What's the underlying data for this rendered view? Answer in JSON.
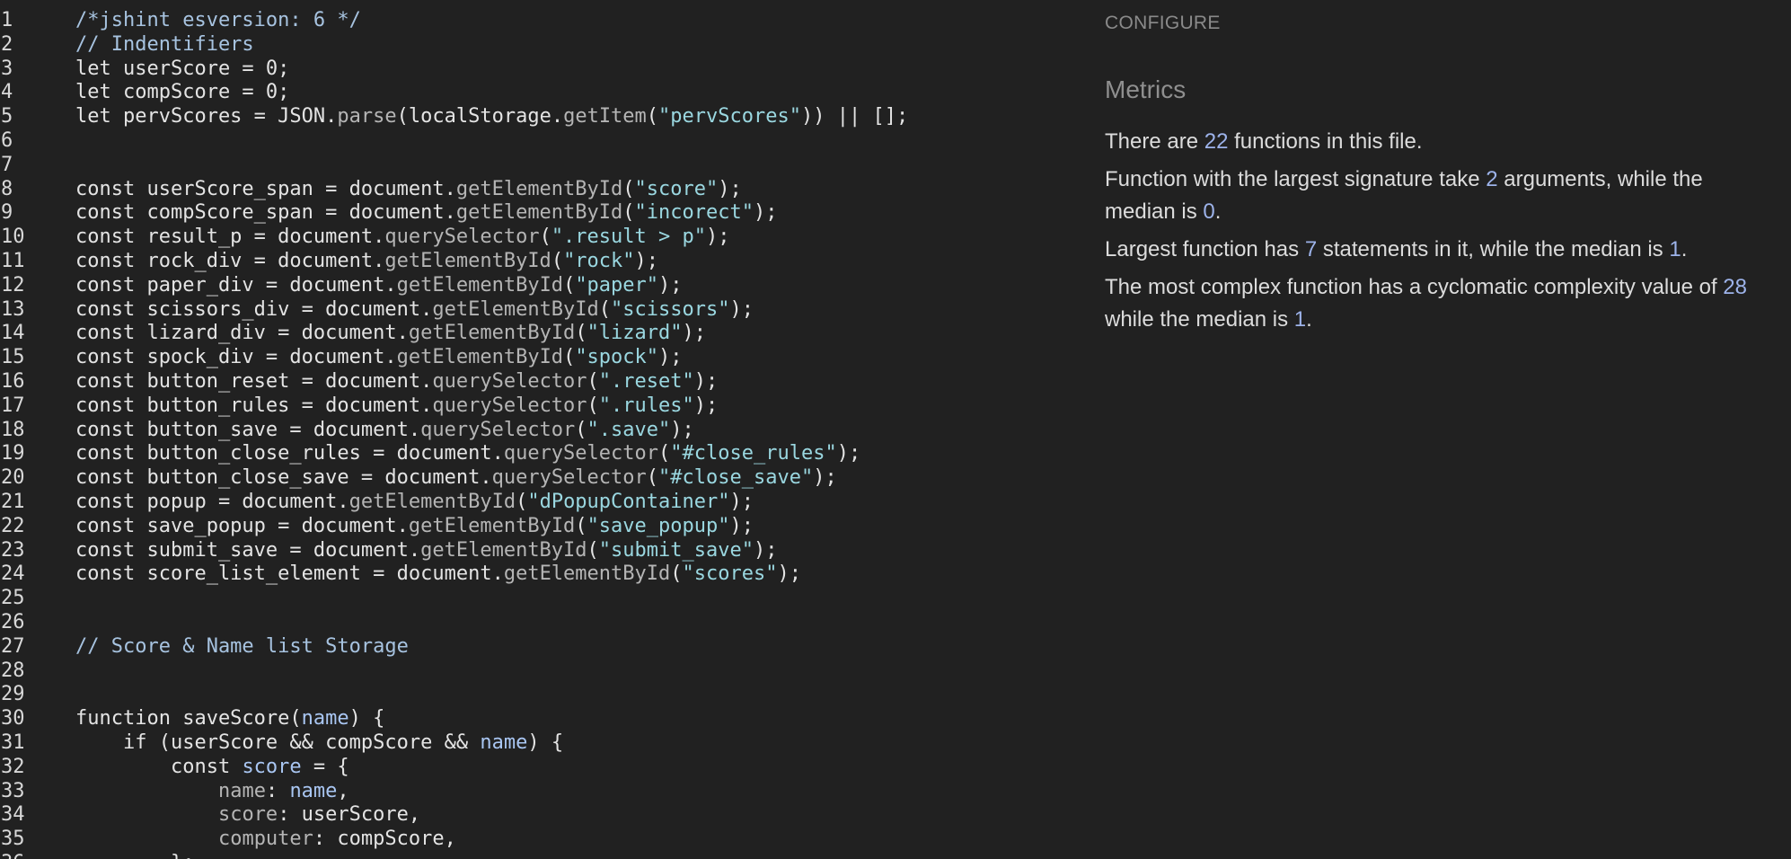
{
  "editor": {
    "lines": [
      [
        {
          "t": "/*jshint esversion: 6 */",
          "c": "comment"
        }
      ],
      [
        {
          "t": "// Indentifiers",
          "c": "comment"
        }
      ],
      [
        {
          "t": "let userScore = 0;",
          "c": "plain"
        }
      ],
      [
        {
          "t": "let compScore = 0;",
          "c": "plain"
        }
      ],
      [
        {
          "t": "let pervScores = JSON.",
          "c": "plain"
        },
        {
          "t": "parse",
          "c": "method"
        },
        {
          "t": "(localStorage.",
          "c": "plain"
        },
        {
          "t": "getItem",
          "c": "method"
        },
        {
          "t": "(",
          "c": "plain"
        },
        {
          "t": "\"pervScores\"",
          "c": "string"
        },
        {
          "t": ")) || [];",
          "c": "plain"
        }
      ],
      [],
      [],
      [
        {
          "t": "const userScore_span = document.",
          "c": "plain"
        },
        {
          "t": "getElementById",
          "c": "method"
        },
        {
          "t": "(",
          "c": "plain"
        },
        {
          "t": "\"score\"",
          "c": "string"
        },
        {
          "t": ");",
          "c": "plain"
        }
      ],
      [
        {
          "t": "const compScore_span = document.",
          "c": "plain"
        },
        {
          "t": "getElementById",
          "c": "method"
        },
        {
          "t": "(",
          "c": "plain"
        },
        {
          "t": "\"incorect\"",
          "c": "string"
        },
        {
          "t": ");",
          "c": "plain"
        }
      ],
      [
        {
          "t": "const result_p = document.",
          "c": "plain"
        },
        {
          "t": "querySelector",
          "c": "method"
        },
        {
          "t": "(",
          "c": "plain"
        },
        {
          "t": "\".result > p\"",
          "c": "string"
        },
        {
          "t": ");",
          "c": "plain"
        }
      ],
      [
        {
          "t": "const rock_div = document.",
          "c": "plain"
        },
        {
          "t": "getElementById",
          "c": "method"
        },
        {
          "t": "(",
          "c": "plain"
        },
        {
          "t": "\"rock\"",
          "c": "string"
        },
        {
          "t": ");",
          "c": "plain"
        }
      ],
      [
        {
          "t": "const paper_div = document.",
          "c": "plain"
        },
        {
          "t": "getElementById",
          "c": "method"
        },
        {
          "t": "(",
          "c": "plain"
        },
        {
          "t": "\"paper\"",
          "c": "string"
        },
        {
          "t": ");",
          "c": "plain"
        }
      ],
      [
        {
          "t": "const scissors_div = document.",
          "c": "plain"
        },
        {
          "t": "getElementById",
          "c": "method"
        },
        {
          "t": "(",
          "c": "plain"
        },
        {
          "t": "\"scissors\"",
          "c": "string"
        },
        {
          "t": ");",
          "c": "plain"
        }
      ],
      [
        {
          "t": "const lizard_div = document.",
          "c": "plain"
        },
        {
          "t": "getElementById",
          "c": "method"
        },
        {
          "t": "(",
          "c": "plain"
        },
        {
          "t": "\"lizard\"",
          "c": "string"
        },
        {
          "t": ");",
          "c": "plain"
        }
      ],
      [
        {
          "t": "const spock_div = document.",
          "c": "plain"
        },
        {
          "t": "getElementById",
          "c": "method"
        },
        {
          "t": "(",
          "c": "plain"
        },
        {
          "t": "\"spock\"",
          "c": "string"
        },
        {
          "t": ");",
          "c": "plain"
        }
      ],
      [
        {
          "t": "const button_reset = document.",
          "c": "plain"
        },
        {
          "t": "querySelector",
          "c": "method"
        },
        {
          "t": "(",
          "c": "plain"
        },
        {
          "t": "\".reset\"",
          "c": "string"
        },
        {
          "t": ");",
          "c": "plain"
        }
      ],
      [
        {
          "t": "const button_rules = document.",
          "c": "plain"
        },
        {
          "t": "querySelector",
          "c": "method"
        },
        {
          "t": "(",
          "c": "plain"
        },
        {
          "t": "\".rules\"",
          "c": "string"
        },
        {
          "t": ");",
          "c": "plain"
        }
      ],
      [
        {
          "t": "const button_save = document.",
          "c": "plain"
        },
        {
          "t": "querySelector",
          "c": "method"
        },
        {
          "t": "(",
          "c": "plain"
        },
        {
          "t": "\".save\"",
          "c": "string"
        },
        {
          "t": ");",
          "c": "plain"
        }
      ],
      [
        {
          "t": "const button_close_rules = document.",
          "c": "plain"
        },
        {
          "t": "querySelector",
          "c": "method"
        },
        {
          "t": "(",
          "c": "plain"
        },
        {
          "t": "\"#close_rules\"",
          "c": "string"
        },
        {
          "t": ");",
          "c": "plain"
        }
      ],
      [
        {
          "t": "const button_close_save = document.",
          "c": "plain"
        },
        {
          "t": "querySelector",
          "c": "method"
        },
        {
          "t": "(",
          "c": "plain"
        },
        {
          "t": "\"#close_save\"",
          "c": "string"
        },
        {
          "t": ");",
          "c": "plain"
        }
      ],
      [
        {
          "t": "const popup = document.",
          "c": "plain"
        },
        {
          "t": "getElementById",
          "c": "method"
        },
        {
          "t": "(",
          "c": "plain"
        },
        {
          "t": "\"dPopupContainer\"",
          "c": "string"
        },
        {
          "t": ");",
          "c": "plain"
        }
      ],
      [
        {
          "t": "const save_popup = document.",
          "c": "plain"
        },
        {
          "t": "getElementById",
          "c": "method"
        },
        {
          "t": "(",
          "c": "plain"
        },
        {
          "t": "\"save_popup\"",
          "c": "string"
        },
        {
          "t": ");",
          "c": "plain"
        }
      ],
      [
        {
          "t": "const submit_save = document.",
          "c": "plain"
        },
        {
          "t": "getElementById",
          "c": "method"
        },
        {
          "t": "(",
          "c": "plain"
        },
        {
          "t": "\"submit_save\"",
          "c": "string"
        },
        {
          "t": ");",
          "c": "plain"
        }
      ],
      [
        {
          "t": "const score_list_element = document.",
          "c": "plain"
        },
        {
          "t": "getElementById",
          "c": "method"
        },
        {
          "t": "(",
          "c": "plain"
        },
        {
          "t": "\"scores\"",
          "c": "string"
        },
        {
          "t": ");",
          "c": "plain"
        }
      ],
      [],
      [],
      [
        {
          "t": "// Score & Name list Storage",
          "c": "comment"
        }
      ],
      [],
      [],
      [
        {
          "t": "function saveScore(",
          "c": "plain"
        },
        {
          "t": "name",
          "c": "param"
        },
        {
          "t": ") {",
          "c": "plain"
        }
      ],
      [
        {
          "t": "    if (userScore && compScore && ",
          "c": "plain"
        },
        {
          "t": "name",
          "c": "param"
        },
        {
          "t": ") {",
          "c": "plain"
        }
      ],
      [
        {
          "t": "        const ",
          "c": "plain"
        },
        {
          "t": "score",
          "c": "param"
        },
        {
          "t": " = {",
          "c": "plain"
        }
      ],
      [
        {
          "t": "            ",
          "c": "plain"
        },
        {
          "t": "name",
          "c": "method"
        },
        {
          "t": ": ",
          "c": "plain"
        },
        {
          "t": "name",
          "c": "param"
        },
        {
          "t": ",",
          "c": "plain"
        }
      ],
      [
        {
          "t": "            ",
          "c": "plain"
        },
        {
          "t": "score",
          "c": "method"
        },
        {
          "t": ": userScore,",
          "c": "plain"
        }
      ],
      [
        {
          "t": "            ",
          "c": "plain"
        },
        {
          "t": "computer",
          "c": "method"
        },
        {
          "t": ": compScore,",
          "c": "plain"
        }
      ],
      [
        {
          "t": "        };",
          "c": "plain"
        }
      ]
    ]
  },
  "panel": {
    "configure_label": "CONFIGURE",
    "title": "Metrics",
    "metrics": [
      [
        {
          "t": "There are "
        },
        {
          "t": "22",
          "n": true
        },
        {
          "t": " functions in this file."
        }
      ],
      [
        {
          "t": "Function with the largest signature take "
        },
        {
          "t": "2",
          "n": true
        },
        {
          "t": " arguments, while the median is "
        },
        {
          "t": "0",
          "n": true
        },
        {
          "t": "."
        }
      ],
      [
        {
          "t": "Largest function has "
        },
        {
          "t": "7",
          "n": true
        },
        {
          "t": " statements in it, while the median is "
        },
        {
          "t": "1",
          "n": true
        },
        {
          "t": "."
        }
      ],
      [
        {
          "t": "The most complex function has a cyclomatic complexity value of "
        },
        {
          "t": "28",
          "n": true
        },
        {
          "t": " while the median is "
        },
        {
          "t": "1",
          "n": true
        },
        {
          "t": "."
        }
      ]
    ]
  },
  "colors": {
    "background": "#212121",
    "comment": "#a7c3e0",
    "string": "#9ad7e0",
    "number_highlight": "#9db3ea"
  }
}
